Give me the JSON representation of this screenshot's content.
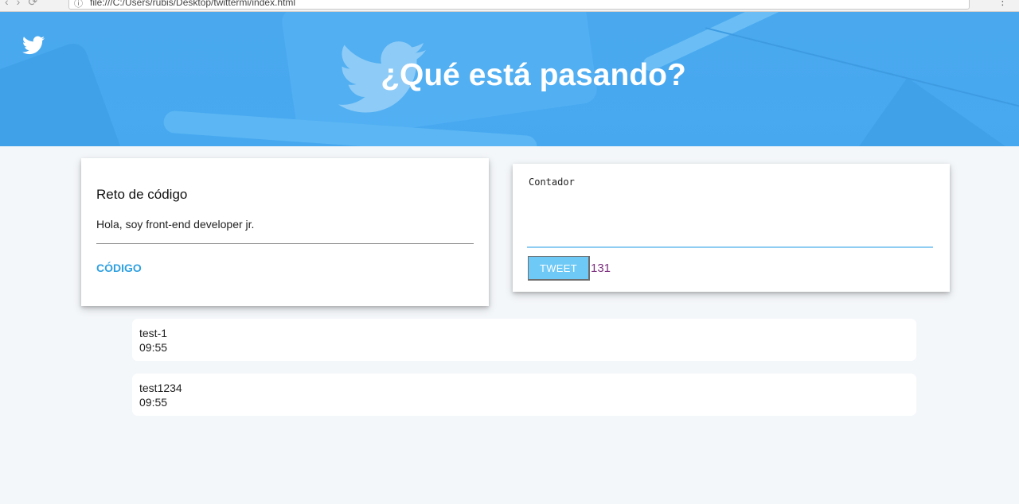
{
  "browser": {
    "url": "file:///C:/Users/rubis/Desktop/twittermi/index.html"
  },
  "header": {
    "title": "¿Qué está pasando?"
  },
  "profile": {
    "title": "Reto de código",
    "description": "Hola, soy front-end developer jr.",
    "link_label": "CÓDIGO"
  },
  "composer": {
    "placeholder": "Contador",
    "button_label": "TWEET",
    "counter": "131"
  },
  "tweets": [
    {
      "text": "test-1",
      "time": "09:55"
    },
    {
      "text": "test1234",
      "time": "09:55"
    }
  ],
  "colors": {
    "header_bg": "#47a8f0",
    "accent": "#2ea0e0",
    "button_bg": "#6ec9f6",
    "counter": "#7b2e7e",
    "page_bg": "#f4f7fa"
  }
}
